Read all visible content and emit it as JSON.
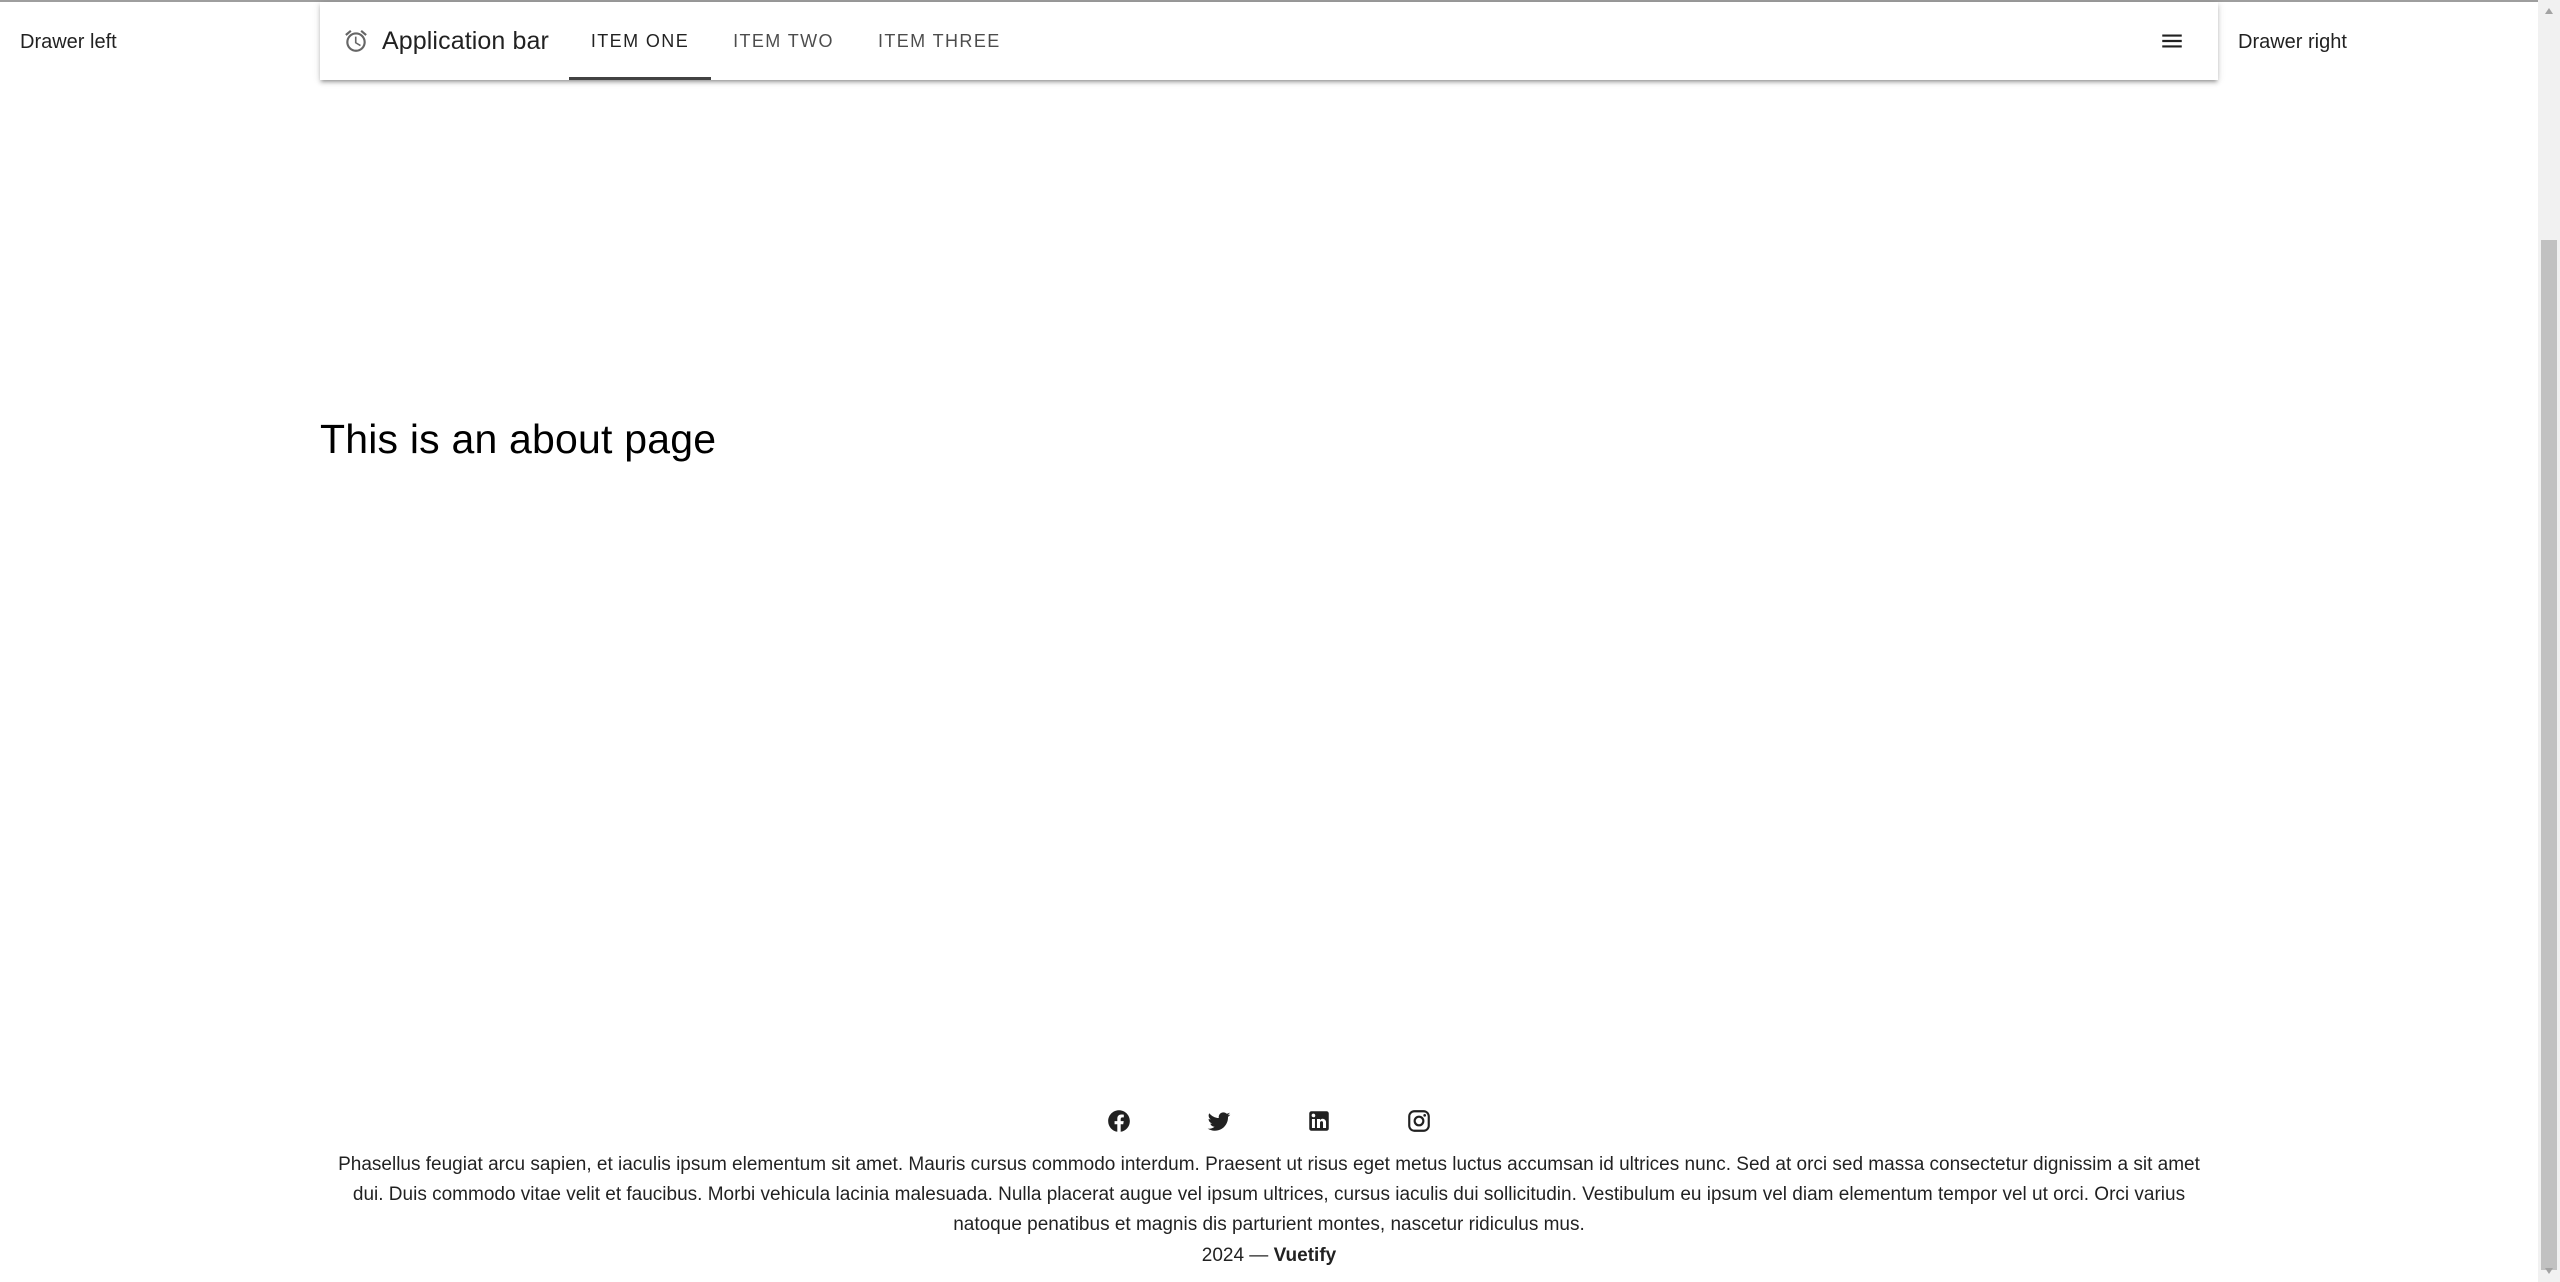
{
  "drawer_left": {
    "label": "Drawer left"
  },
  "drawer_right": {
    "label": "Drawer right"
  },
  "app_bar": {
    "icon": "alarm-clock-icon",
    "title": "Application bar",
    "tabs": [
      {
        "label": "ITEM ONE",
        "active": true
      },
      {
        "label": "ITEM TWO",
        "active": false
      },
      {
        "label": "ITEM THREE",
        "active": false
      }
    ],
    "menu_icon": "hamburger-menu-icon"
  },
  "main": {
    "heading": "This is an about page"
  },
  "footer": {
    "social": [
      {
        "icon": "facebook-icon"
      },
      {
        "icon": "twitter-icon"
      },
      {
        "icon": "linkedin-icon"
      },
      {
        "icon": "instagram-icon"
      }
    ],
    "text": "Phasellus feugiat arcu sapien, et iaculis ipsum elementum sit amet. Mauris cursus commodo interdum. Praesent ut risus eget metus luctus accumsan id ultrices nunc. Sed at orci sed massa consectetur dignissim a sit amet dui. Duis commodo vitae velit et faucibus. Morbi vehicula lacinia malesuada. Nulla placerat augue vel ipsum ultrices, cursus iaculis dui sollicitudin. Vestibulum eu ipsum vel diam elementum tempor vel ut orci. Orci varius natoque penatibus et magnis dis parturient montes, nascetur ridiculus mus.",
    "year": "2024 —",
    "brand": "Vuetify"
  },
  "colors": {
    "tab_indicator": "#424242",
    "text": "#000000de"
  }
}
